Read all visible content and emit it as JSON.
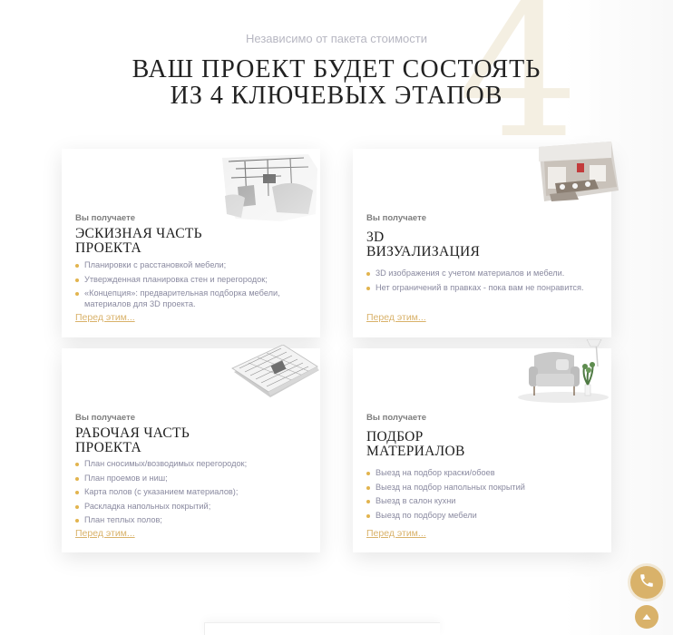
{
  "section": {
    "subtitle": "Независимо от пакета стоимости",
    "title_line1": "ВАШ ПРОЕКТ БУДЕТ СОСТОЯТЬ",
    "title_line2": "ИЗ 4 КЛЮЧЕВЫХ ЭТАПОВ",
    "bg_number": "4"
  },
  "cards": [
    {
      "label": "Вы получаете",
      "title_line1": "ЭСКИЗНАЯ ЧАСТЬ",
      "title_line2": "ПРОЕКТА",
      "items": [
        "Планировки с расстановкой мебели;",
        "Утвержденная планировка стен и перегородок;",
        "«Концепция»: предварительная подборка мебели, материалов для 3D проекта."
      ],
      "link": "Перед этим...",
      "image": "sketch-interior-image"
    },
    {
      "label": "Вы получаете",
      "title_line1": "3D",
      "title_line2": "ВИЗУАЛИЗАЦИЯ",
      "items": [
        "3D изображения с учетом материалов и мебели.",
        "Нет ограничений в правках - пока вам не понравится."
      ],
      "link": "Перед этим...",
      "image": "3d-render-image"
    },
    {
      "label": "Вы получаете",
      "title_line1": "РАБОЧАЯ ЧАСТЬ",
      "title_line2": "ПРОЕКТА",
      "items": [
        "План сносимых/возводимых перегородок;",
        "План проемов и ниш;",
        "Карта полов (с указанием материалов);",
        "Раскладка напольных покрытий;",
        "План теплых полов;"
      ],
      "link": "Перед этим...",
      "image": "blueprint-papers-image"
    },
    {
      "label": "Вы получаете",
      "title_line1": "ПОДБОР",
      "title_line2": "МАТЕРИАЛОВ",
      "items": [
        "Выезд на подбор краски/обоев",
        "Выезд на подбор напольных покрытий",
        "Выезд в салон кухни",
        "Выезд по подбору мебели"
      ],
      "link": "Перед этим...",
      "image": "armchair-image"
    }
  ],
  "colors": {
    "accent": "#d9b26a",
    "bullet": "#e2b44e",
    "fab": "#d9b26a"
  },
  "fabs": {
    "phone_icon": "phone-icon",
    "up_icon": "arrow-up-icon"
  }
}
